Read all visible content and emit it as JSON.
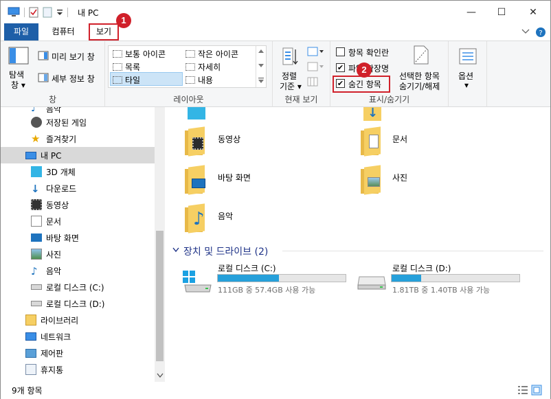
{
  "window": {
    "title": "내 PC",
    "min_icon": "—",
    "max_icon": "☐",
    "close_icon": "✕"
  },
  "tabs": {
    "file": "파일",
    "computer": "컴퓨터",
    "view": "보기"
  },
  "badges": {
    "one": "1",
    "two": "2"
  },
  "ribbon": {
    "pane": {
      "nav_pane_line1": "탐색",
      "nav_pane_line2": "창 ▾",
      "preview": "미리 보기 창",
      "details": "세부 정보 창",
      "label": "창"
    },
    "layout": {
      "medium_icons": "보통 아이콘",
      "small_icons": "작은 아이콘",
      "list": "목록",
      "details": "자세히",
      "tiles": "타일",
      "content": "내용",
      "label": "레이아웃"
    },
    "current_view": {
      "sort_line1": "정렬",
      "sort_line2": "기준 ▾",
      "label": "현재 보기"
    },
    "show_hide": {
      "item_checkboxes": "항목 확인란",
      "file_ext": "파일 확장명",
      "hidden_items": "숨긴 항목",
      "hide_selected_line1": "선택한 항목",
      "hide_selected_line2": "숨기기/해제",
      "label": "표시/숨기기"
    },
    "options": {
      "label_line1": "옵션",
      "label_line2": "▾"
    }
  },
  "nav": {
    "items": [
      {
        "label": "음악",
        "icon": "music-icon"
      },
      {
        "label": "저장된 게임",
        "icon": "game-icon"
      },
      {
        "label": "즐겨찾기",
        "icon": "star-icon"
      },
      {
        "label": "내 PC",
        "icon": "pc-icon"
      },
      {
        "label": "3D 개체",
        "icon": "cube-icon"
      },
      {
        "label": "다운로드",
        "icon": "download-icon"
      },
      {
        "label": "동영상",
        "icon": "film-icon"
      },
      {
        "label": "문서",
        "icon": "document-icon"
      },
      {
        "label": "바탕 화면",
        "icon": "desktop-icon"
      },
      {
        "label": "사진",
        "icon": "picture-icon"
      },
      {
        "label": "음악",
        "icon": "music-icon"
      },
      {
        "label": "로컬 디스크 (C:)",
        "icon": "drive-icon"
      },
      {
        "label": "로컬 디스크 (D:)",
        "icon": "drive-icon"
      },
      {
        "label": "라이브러리",
        "icon": "library-icon"
      },
      {
        "label": "네트워크",
        "icon": "network-icon"
      },
      {
        "label": "제어판",
        "icon": "control-panel-icon"
      },
      {
        "label": "휴지통",
        "icon": "recycle-bin-icon"
      }
    ]
  },
  "folders": {
    "videos": "동영상",
    "documents": "문서",
    "desktop": "바탕 화면",
    "pictures": "사진",
    "music": "음악"
  },
  "devices": {
    "header": "장치 및 드라이브 (2)",
    "c": {
      "name": "로컬 디스크 (C:)",
      "info": "111GB 중 57.4GB 사용 가능",
      "used_fraction": 0.48
    },
    "d": {
      "name": "로컬 디스크 (D:)",
      "info": "1.81TB 중 1.40TB 사용 가능",
      "used_fraction": 0.23
    }
  },
  "status": {
    "count": "9개 항목"
  },
  "colors": {
    "accent": "#1e5fa8",
    "highlight_red": "#d0202a",
    "folder": "#f6cf63",
    "drive_bar": "#26a0da"
  }
}
